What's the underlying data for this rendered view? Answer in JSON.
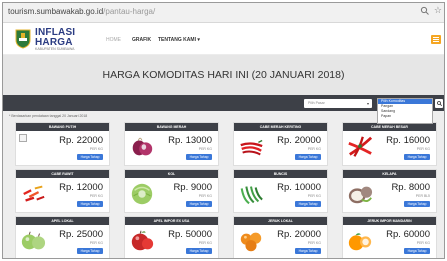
{
  "browser": {
    "url_host": "tourism.sumbawakab.go.id",
    "url_path": "/pantau-harga/"
  },
  "header": {
    "brand_main": "INFLASI",
    "brand_main2": "HARGA",
    "brand_sub": "KABUPATEN SUMBAWA",
    "nav": [
      "HOME",
      "GRAFIK",
      "TENTANG KAMI ▾"
    ],
    "accent_color": "#f5a623",
    "brand_color": "#2a3b82"
  },
  "hero": {
    "title": "HARGA KOMODITAS HARI INI (20 JANUARI 2018)"
  },
  "filter": {
    "pasar_placeholder": "Pilih Pasar",
    "komoditas_placeholder": "Pilih komoditas",
    "dropdown_options": [
      "Pilih Komoditas",
      "Pangan",
      "Sandang",
      "Papan"
    ],
    "dropdown_selected_index": 0
  },
  "content": {
    "note": "* Berdasarkan pendataan tanggal 20 Januari 2018",
    "button_label": "Harga Tahap",
    "items": [
      {
        "title": "BAWANG PUTIH",
        "price": "Rp. 22000",
        "unit": "PER KG",
        "icon": "broken-image-icon"
      },
      {
        "title": "BAWANG MERAH",
        "price": "Rp. 13000",
        "unit": "PER KG",
        "icon": "shallot-icon"
      },
      {
        "title": "CABE MERAH KERITING",
        "price": "Rp. 20000",
        "unit": "PER KG",
        "icon": "red-chili-icon"
      },
      {
        "title": "CABE MERAH BESAR",
        "price": "Rp. 16000",
        "unit": "PER KG",
        "icon": "big-chili-icon"
      },
      {
        "title": "CABE RAWIT",
        "price": "Rp. 12000",
        "unit": "PER KG",
        "icon": "bird-chili-icon"
      },
      {
        "title": "KOL",
        "price": "Rp. 9000",
        "unit": "PER KG",
        "icon": "cabbage-icon"
      },
      {
        "title": "BUNCIS",
        "price": "Rp. 10000",
        "unit": "PER KG",
        "icon": "green-bean-icon"
      },
      {
        "title": "KELAPA",
        "price": "Rp. 8000",
        "unit": "PER BIJI",
        "icon": "coconut-icon"
      },
      {
        "title": "APEL LOKAL",
        "price": "Rp. 25000",
        "unit": "PER KG",
        "icon": "green-apple-icon"
      },
      {
        "title": "APEL IMPOR EX USA",
        "price": "Rp. 50000",
        "unit": "PER KG",
        "icon": "red-apple-icon"
      },
      {
        "title": "JERUK LOKAL",
        "price": "Rp. 20000",
        "unit": "PER KG",
        "icon": "orange-icon"
      },
      {
        "title": "JERUK IMPOR MANDARIN",
        "price": "Rp. 60000",
        "unit": "PER KG",
        "icon": "mandarin-icon"
      }
    ]
  }
}
